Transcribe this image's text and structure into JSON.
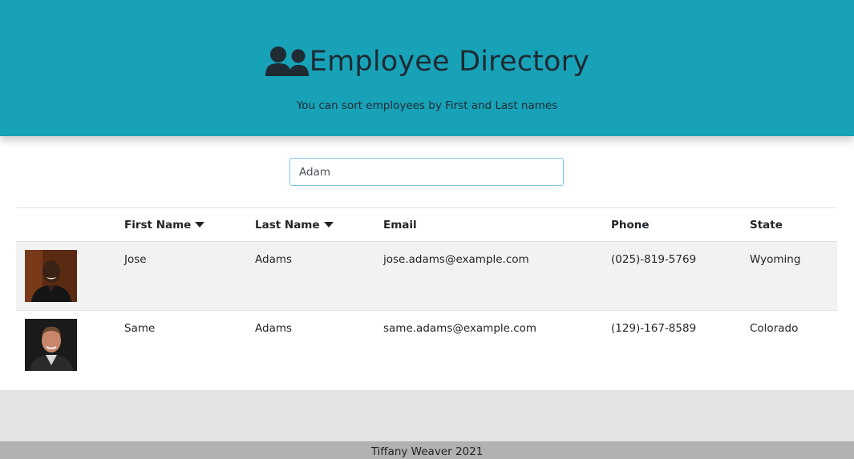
{
  "header": {
    "icon": "users-icon",
    "title": "Employee Directory",
    "subtitle": "You can sort employees by First and Last names",
    "background_color": "#17a2b8"
  },
  "search": {
    "value": "Adam",
    "placeholder": ""
  },
  "table": {
    "columns": [
      "",
      "First Name",
      "Last Name",
      "Email",
      "Phone",
      "State"
    ],
    "sortable_columns": [
      "First Name",
      "Last Name"
    ],
    "rows": [
      {
        "photo": "employee-photo",
        "first": "Jose",
        "last": "Adams",
        "email": "jose.adams@example.com",
        "phone": "(025)-819-5769",
        "state": "Wyoming"
      },
      {
        "photo": "employee-photo",
        "first": "Same",
        "last": "Adams",
        "email": "same.adams@example.com",
        "phone": "(129)-167-8589",
        "state": "Colorado"
      }
    ]
  },
  "footer": {
    "text": "Tiffany Weaver 2021"
  }
}
